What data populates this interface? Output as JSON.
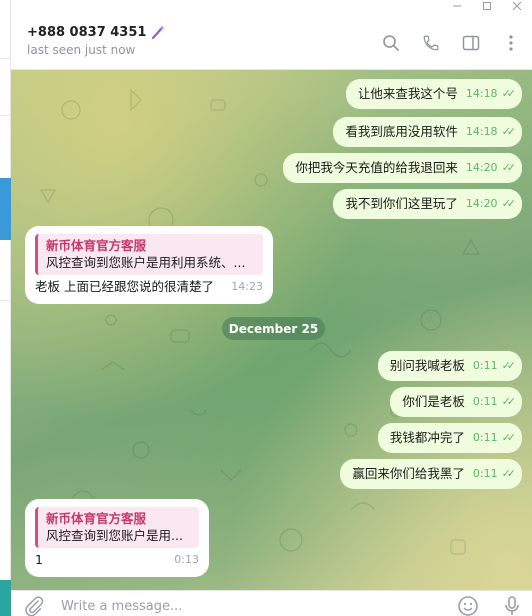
{
  "header": {
    "contact_name": "+888 0837 4351",
    "status": "last seen just now",
    "icons": [
      "search-icon",
      "phone-icon",
      "sidebar-toggle-icon",
      "more-vertical-icon"
    ]
  },
  "window_controls": [
    "minimize",
    "maximize",
    "close"
  ],
  "messages": [
    {
      "side": "out",
      "text": "让他来查我这个号",
      "time": "14:18"
    },
    {
      "side": "out",
      "text": "看我到底用没用软件",
      "time": "14:18"
    },
    {
      "side": "out",
      "text": "你把我今天充值的给我退回来",
      "time": "14:20"
    },
    {
      "side": "out",
      "text": "我不到你们这里玩了",
      "time": "14:20"
    },
    {
      "side": "in",
      "quote_name": "新币体育官方客服",
      "quote_text": "风控查询到您账户是用利用系统、...",
      "text": "老板 上面已经跟您说的很清楚了",
      "time": "14:23"
    },
    {
      "side": "out",
      "text": "别问我喊老板",
      "time": "0:11"
    },
    {
      "side": "out",
      "text": "你们是老板",
      "time": "0:11"
    },
    {
      "side": "out",
      "text": "我钱都冲完了",
      "time": "0:11"
    },
    {
      "side": "out",
      "text": "赢回来你们给我黑了",
      "time": "0:11"
    },
    {
      "side": "in",
      "quote_name": "新币体育官方客服",
      "quote_text": "风控查询到您账户是用...",
      "text": "1",
      "time": "0:13"
    }
  ],
  "date_separator": "December 25",
  "input": {
    "placeholder": "Write a message..."
  },
  "colors": {
    "outgoing_bubble": "#effdde",
    "incoming_bubble": "#ffffff",
    "quote_accent": "#d44e7f",
    "read_ticks": "#5fb563"
  }
}
